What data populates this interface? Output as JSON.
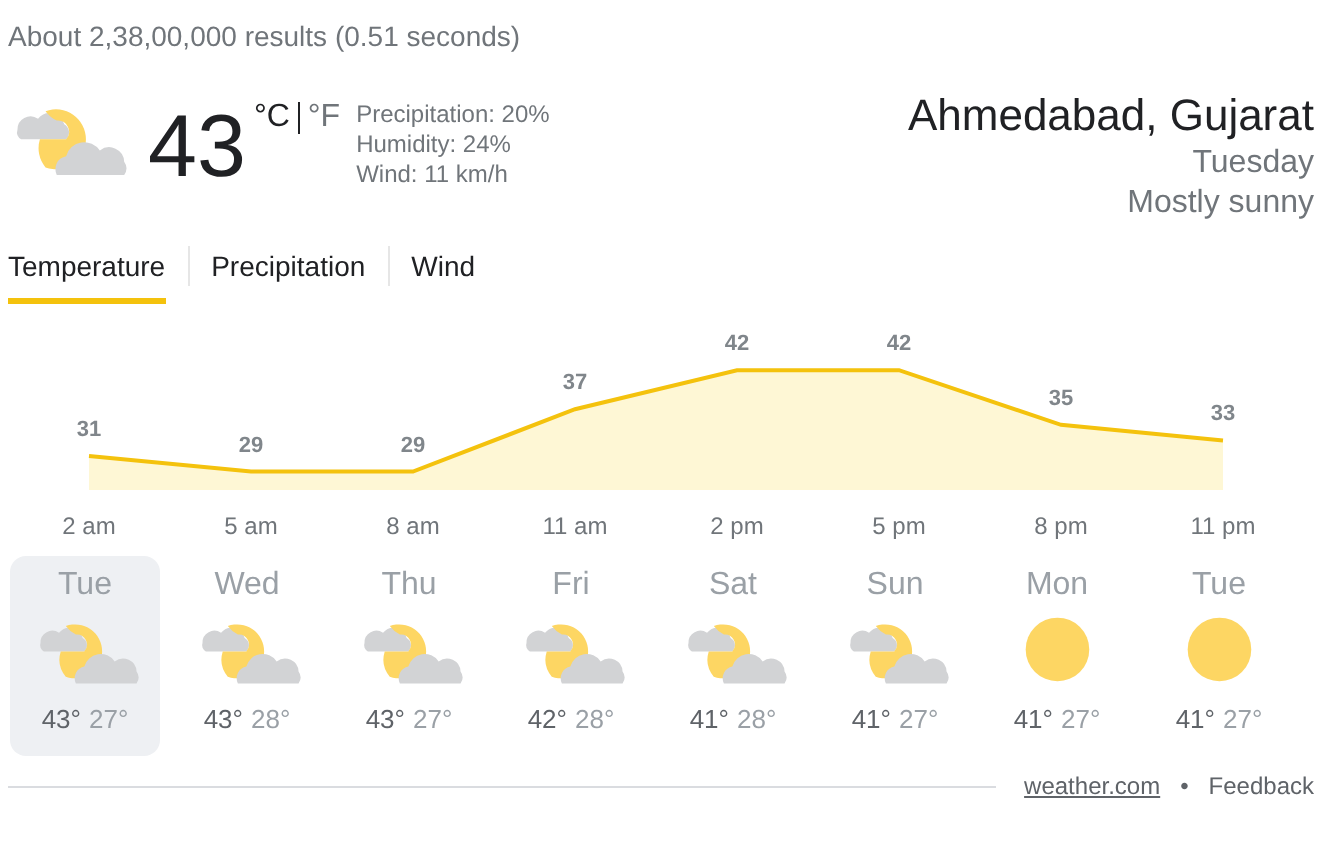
{
  "results_info": "About 2,38,00,000 results (0.51 seconds)",
  "current": {
    "kind": "partly_cloudy",
    "temperature": "43",
    "units": [
      {
        "label": "°C",
        "selected": true
      },
      {
        "label": "°F",
        "selected": false
      }
    ],
    "details": [
      "Precipitation: 20%",
      "Humidity: 24%",
      "Wind: 11 km/h"
    ]
  },
  "location": {
    "place": "Ahmedabad, Gujarat",
    "day": "Tuesday",
    "description": "Mostly sunny"
  },
  "tabs": [
    {
      "label": "Temperature",
      "selected": true
    },
    {
      "label": "Precipitation",
      "selected": false
    },
    {
      "label": "Wind",
      "selected": false
    }
  ],
  "chart_data": {
    "type": "area",
    "categories": [
      "2 am",
      "5 am",
      "8 am",
      "11 am",
      "2 pm",
      "5 pm",
      "8 pm",
      "11 pm"
    ],
    "series": [
      {
        "color": "#f4c20d",
        "values": [
          31,
          29,
          29,
          37,
          42,
          42,
          35,
          33
        ]
      }
    ],
    "data_labels": true
  },
  "days": [
    {
      "day": "Tue",
      "kind": "partly_cloudy",
      "high": "43°",
      "low": "27°",
      "selected": true
    },
    {
      "day": "Wed",
      "kind": "partly_cloudy",
      "high": "43°",
      "low": "28°",
      "selected": false
    },
    {
      "day": "Thu",
      "kind": "partly_cloudy",
      "high": "43°",
      "low": "27°",
      "selected": false
    },
    {
      "day": "Fri",
      "kind": "partly_cloudy",
      "high": "42°",
      "low": "28°",
      "selected": false
    },
    {
      "day": "Sat",
      "kind": "partly_cloudy",
      "high": "41°",
      "low": "28°",
      "selected": false
    },
    {
      "day": "Sun",
      "kind": "partly_cloudy",
      "high": "41°",
      "low": "27°",
      "selected": false
    },
    {
      "day": "Mon",
      "kind": "sunny",
      "high": "41°",
      "low": "27°",
      "selected": false
    },
    {
      "day": "Tue",
      "kind": "sunny",
      "high": "41°",
      "low": "27°",
      "selected": false
    }
  ],
  "footer": {
    "source": "weather.com",
    "separator": "•",
    "feedback": "Feedback"
  }
}
